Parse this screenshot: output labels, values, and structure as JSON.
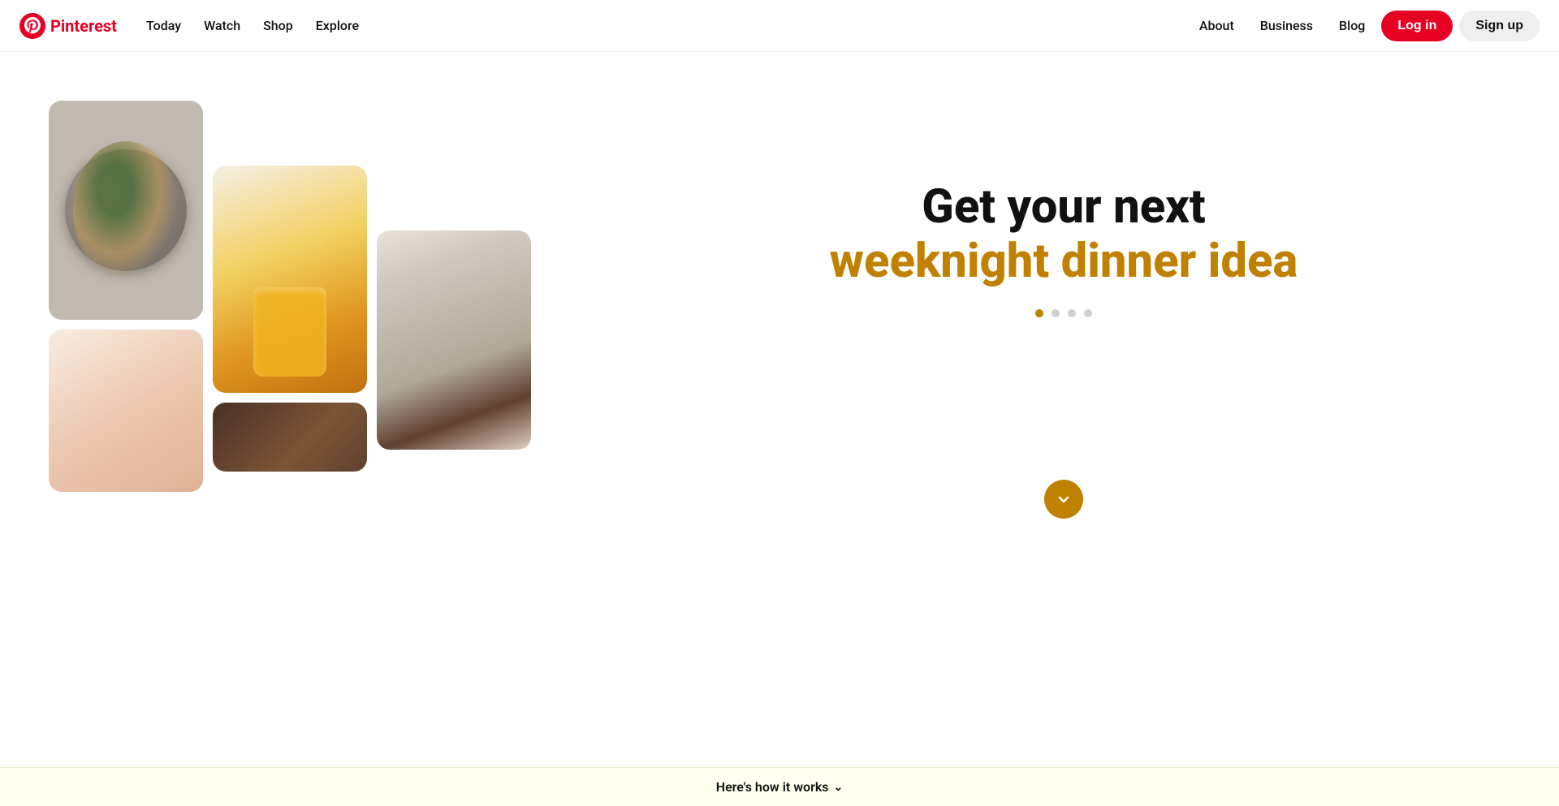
{
  "brand": {
    "name": "Pinterest",
    "logo_alt": "Pinterest logo"
  },
  "navbar": {
    "left_links": [
      {
        "id": "today",
        "label": "Today"
      },
      {
        "id": "watch",
        "label": "Watch"
      },
      {
        "id": "shop",
        "label": "Shop"
      },
      {
        "id": "explore",
        "label": "Explore"
      }
    ],
    "right_links": [
      {
        "id": "about",
        "label": "About"
      },
      {
        "id": "business",
        "label": "Business"
      },
      {
        "id": "blog",
        "label": "Blog"
      }
    ],
    "login_label": "Log in",
    "signup_label": "Sign up"
  },
  "hero": {
    "title_line1": "Get your next",
    "title_line2": "weeknight dinner idea",
    "dots_count": 4,
    "active_dot": 0
  },
  "bottom_bar": {
    "how_it_works": "Here's how it works"
  },
  "colors": {
    "pinterest_red": "#E60023",
    "hero_gold": "#c08000",
    "scroll_btn_bg": "#c08000"
  }
}
